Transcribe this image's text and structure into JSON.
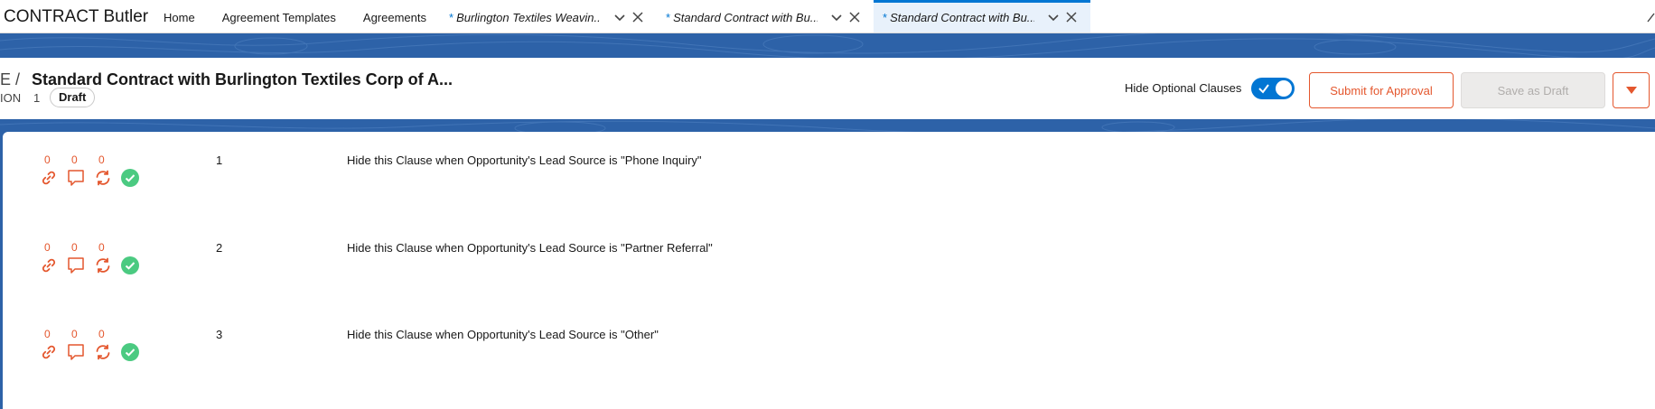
{
  "app": {
    "name": "CONTRACT Butler"
  },
  "nav": {
    "items": [
      "Home",
      "Agreement Templates",
      "Agreements"
    ],
    "tabs": [
      {
        "marker": "*",
        "label": "Burlington Textiles Weavin...",
        "active": false
      },
      {
        "marker": "*",
        "label": "Standard Contract with Bu...",
        "active": false
      },
      {
        "marker": "*",
        "label": "Standard Contract with Bu...",
        "active": true
      }
    ]
  },
  "header": {
    "breadcrumb": "E /",
    "title": "Standard Contract with Burlington Textiles Corp of A...",
    "version_label": "ION",
    "version_number": "1",
    "status": "Draft",
    "hide_optional_label": "Hide Optional Clauses",
    "hide_optional_on": true,
    "submit_label": "Submit for Approval",
    "save_draft_label": "Save as Draft"
  },
  "clauses": [
    {
      "counts": [
        "0",
        "0",
        "0"
      ],
      "number": "1",
      "text": "Hide this Clause when Opportunity's Lead Source is \"Phone Inquiry\""
    },
    {
      "counts": [
        "0",
        "0",
        "0"
      ],
      "number": "2",
      "text": "Hide this Clause when Opportunity's Lead Source is \"Partner Referral\""
    },
    {
      "counts": [
        "0",
        "0",
        "0"
      ],
      "number": "3",
      "text": "Hide this Clause when Opportunity's Lead Source is \"Other\""
    }
  ],
  "icons": {
    "clause_row": [
      "link-icon",
      "comment-icon",
      "sync-icon",
      "approved-check-icon"
    ],
    "tab_controls": [
      "chevron-down-icon",
      "close-icon"
    ],
    "menu": "caret-down-icon"
  },
  "colors": {
    "accent": "#0176d3",
    "brand_orange": "#e4572e",
    "banner_blue": "#2d62a8",
    "approved_green": "#4bca81"
  }
}
